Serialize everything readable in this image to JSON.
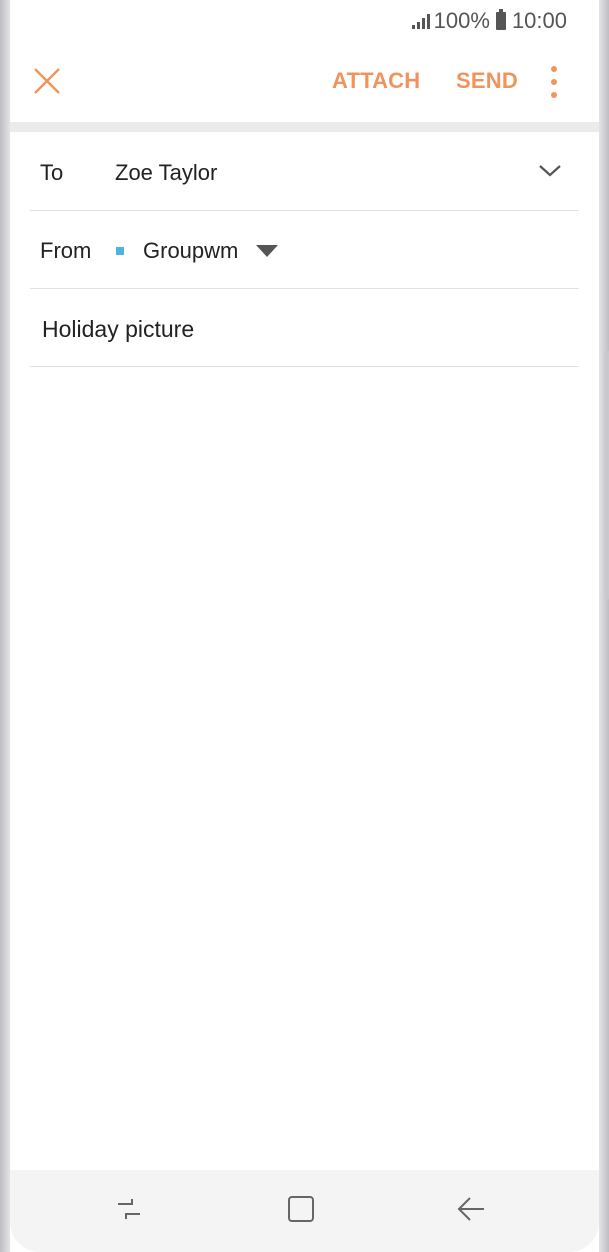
{
  "status_bar": {
    "battery": "100%",
    "time": "10:00",
    "icons": [
      "signal-icon",
      "battery-icon"
    ]
  },
  "action_bar": {
    "close_icon": "close-icon",
    "attach_label": "ATTACH",
    "send_label": "SEND",
    "more_icon": "more-vert-icon",
    "accent_color": "#f0945e"
  },
  "compose": {
    "to": {
      "label": "To",
      "value": "Zoe Taylor",
      "expand_icon": "chevron-down-icon"
    },
    "from": {
      "label": "From",
      "account": "Groupwm",
      "account_color": "#4fb3e0",
      "dropdown_icon": "caret-down-icon"
    },
    "subject": {
      "value": "Holiday picture"
    },
    "body": {
      "value": ""
    }
  },
  "nav_bar": {
    "icons": [
      "recent-apps-icon",
      "home-icon",
      "back-icon"
    ]
  }
}
